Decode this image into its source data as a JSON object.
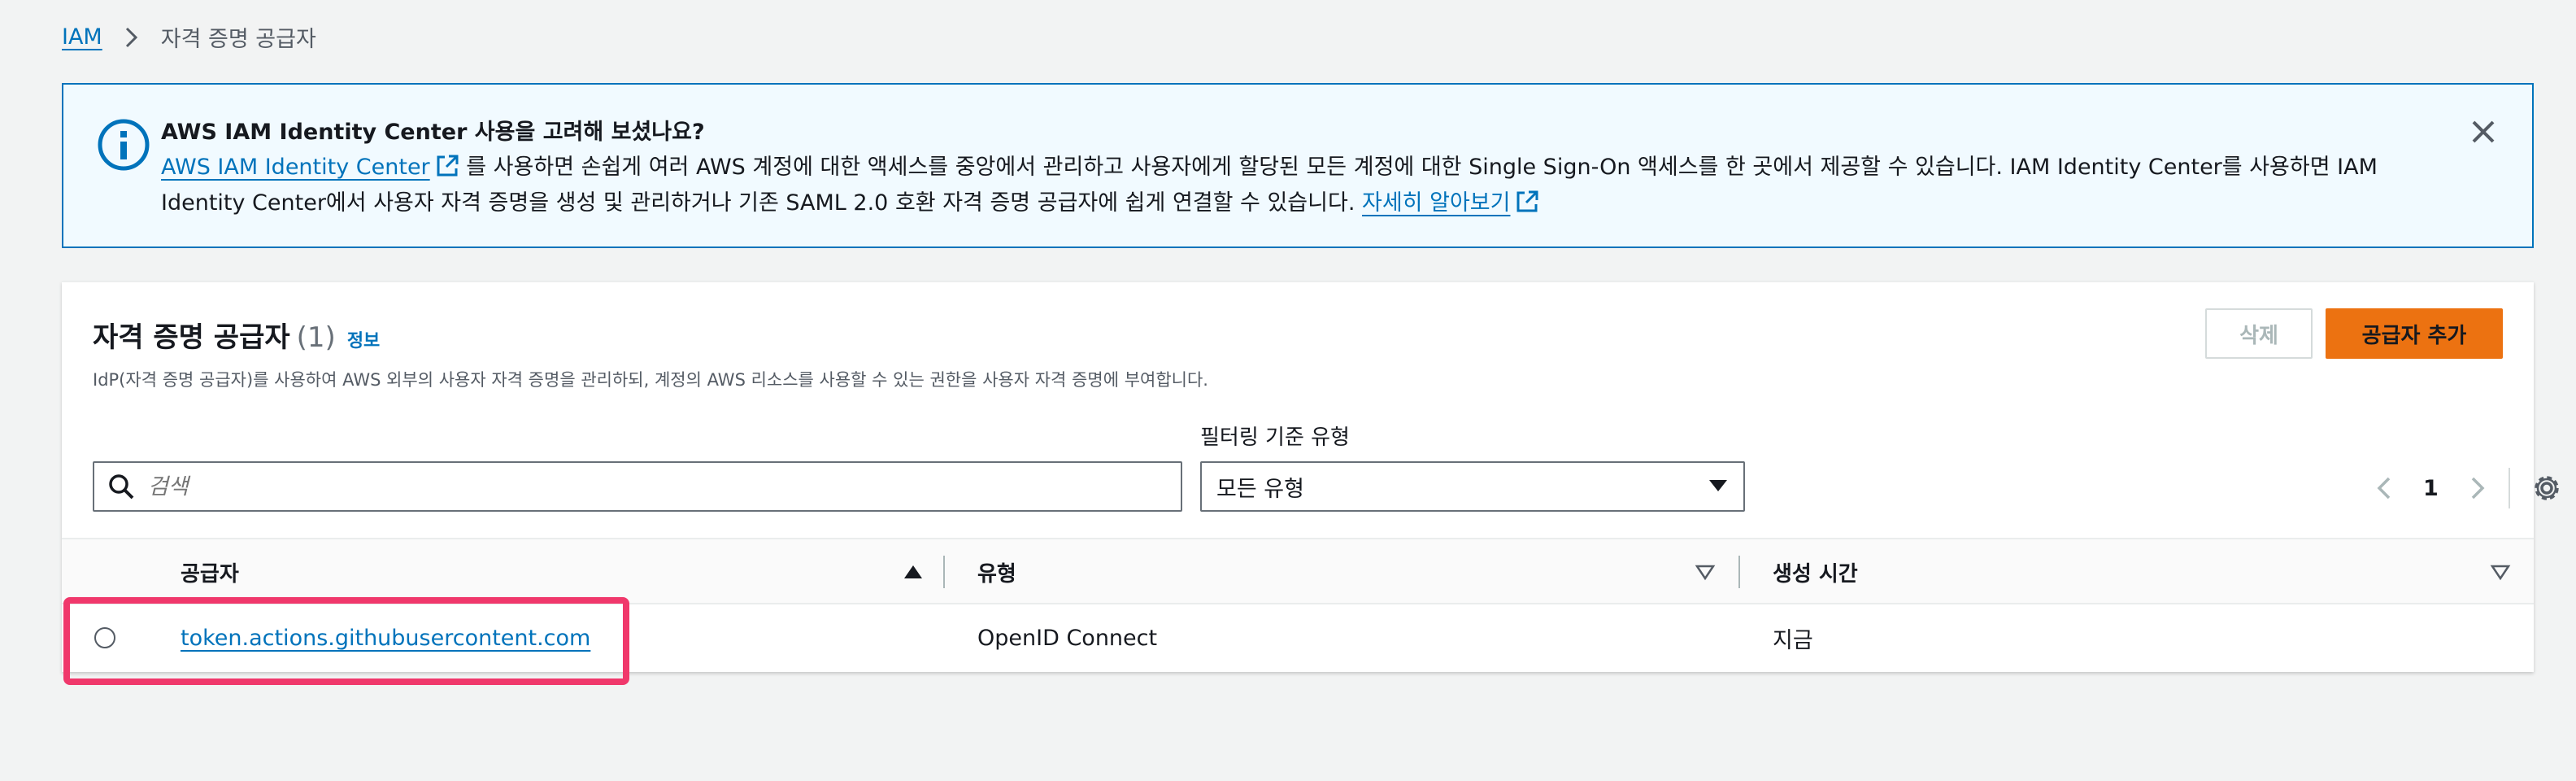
{
  "breadcrumb": {
    "root": "IAM",
    "current": "자격 증명 공급자"
  },
  "banner": {
    "title": "AWS IAM Identity Center 사용을 고려해 보셨나요?",
    "link_text": "AWS IAM Identity Center",
    "body_text": " 를 사용하면 손쉽게 여러 AWS 계정에 대한 액세스를 중앙에서 관리하고 사용자에게 할당된 모든 계정에 대한 Single Sign-On 액세스를 한 곳에서 제공할 수 있습니다. IAM Identity Center를 사용하면 IAM Identity Center에서 사용자 자격 증명을 생성 및 관리하거나 기존 SAML 2.0 호환 자격 증명 공급자에 쉽게 연결할 수 있습니다. ",
    "learn_more": "자세히 알아보기"
  },
  "panel": {
    "title": "자격 증명 공급자",
    "count": "(1)",
    "info": "정보",
    "description": "IdP(자격 증명 공급자)를 사용하여 AWS 외부의 사용자 자격 증명을 관리하되, 계정의 AWS 리소스를 사용할 수 있는 권한을 사용자 자격 증명에 부여합니다.",
    "delete_label": "삭제",
    "add_label": "공급자 추가"
  },
  "filter": {
    "search_placeholder": "검색",
    "type_label": "필터링 기준 유형",
    "type_value": "모든 유형"
  },
  "pagination": {
    "page": "1"
  },
  "table": {
    "columns": [
      "공급자",
      "유형",
      "생성 시간"
    ],
    "rows": [
      {
        "provider": "token.actions.githubusercontent.com",
        "type": "OpenID Connect",
        "created": "지금"
      }
    ]
  },
  "colors": {
    "link": "#0073bb",
    "primary_button": "#ec7211",
    "highlight": "#f0386b",
    "banner_bg": "#f1faff"
  },
  "icons": [
    "chevron-right-icon",
    "info-icon",
    "external-link-icon",
    "close-icon",
    "search-icon",
    "caret-down-icon",
    "chevron-left-icon",
    "gear-icon",
    "sort-ascending-icon",
    "sort-icon"
  ]
}
